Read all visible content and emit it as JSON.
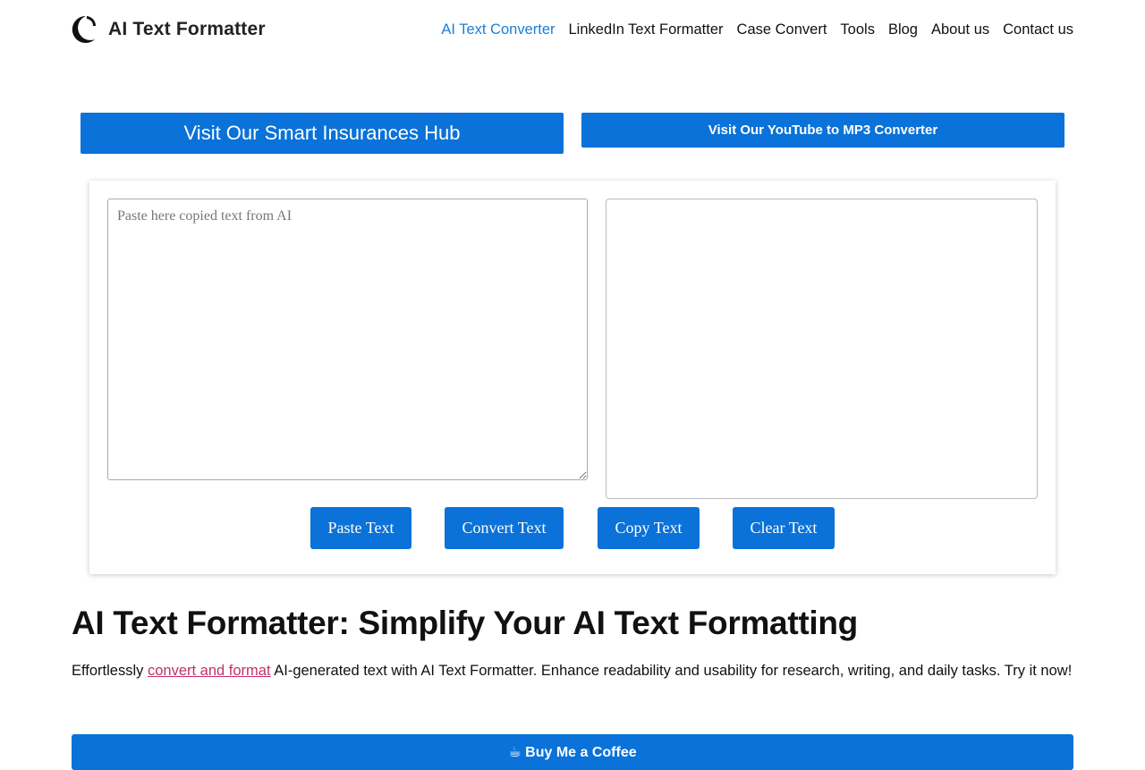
{
  "header": {
    "brand": "AI Text Formatter",
    "logo_icon": "crescent-logo-icon",
    "nav": [
      {
        "label": "AI Text Converter",
        "active": true
      },
      {
        "label": "LinkedIn Text Formatter",
        "active": false
      },
      {
        "label": "Case Convert",
        "active": false
      },
      {
        "label": "Tools",
        "active": false
      },
      {
        "label": "Blog",
        "active": false
      },
      {
        "label": "About us",
        "active": false
      },
      {
        "label": "Contact us",
        "active": false
      }
    ]
  },
  "promos": {
    "insurance": "Visit Our Smart Insurances Hub",
    "youtube": "Visit Our YouTube to MP3 Converter"
  },
  "converter": {
    "input_placeholder": "Paste here copied text from AI",
    "input_value": "",
    "output_value": "",
    "buttons": {
      "paste": "Paste Text",
      "convert": "Convert Text",
      "copy": "Copy Text",
      "clear": "Clear Text"
    }
  },
  "content": {
    "heading": "AI Text Formatter: Simplify Your AI Text Formatting",
    "intro_before": "Effortlessly ",
    "intro_link": "convert and format",
    "intro_after": " AI-generated text with AI Text Formatter. Enhance readability and usability for research, writing, and daily tasks. Try it now!",
    "coffee_button": "☕ Buy Me a Coffee"
  },
  "colors": {
    "primary": "#0a72d8",
    "nav_active": "#1a7ed8",
    "link": "#c2306b"
  }
}
